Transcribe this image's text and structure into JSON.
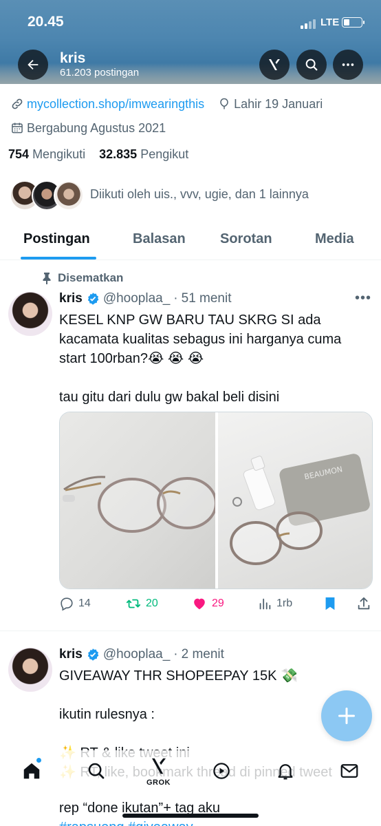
{
  "status_bar": {
    "time": "20.45",
    "network": "LTE"
  },
  "header": {
    "name": "kris",
    "post_count": "61.203 postingan"
  },
  "profile": {
    "website": "mycollection.shop/imwearingthis",
    "birthday": "Lahir 19 Januari",
    "joined": "Bergabung Agustus 2021",
    "following_count": "754",
    "following_label": "Mengikuti",
    "followers_count": "32.835",
    "followers_label": "Pengikut",
    "followed_by": "Diikuti oleh uis., vvv, ugie, dan 1 lainnya"
  },
  "tabs": [
    {
      "label": "Postingan",
      "active": true
    },
    {
      "label": "Balasan",
      "active": false
    },
    {
      "label": "Sorotan",
      "active": false
    },
    {
      "label": "Media",
      "active": false
    }
  ],
  "pinned_label": "Disematkan",
  "tweets": [
    {
      "name": "kris",
      "handle": "@hooplaa_",
      "sep": "·",
      "time": "51 menit",
      "text": "KESEL KNP GW BARU TAU SKRG SI ada kacamata kualitas sebagus ini harganya cuma start 100rban?😭 😭 😭\n\ntau gitu dari dulu gw bakal beli disini",
      "replies": "14",
      "retweets": "20",
      "likes": "29",
      "views": "1rb"
    },
    {
      "name": "kris",
      "handle": "@hooplaa_",
      "sep": "·",
      "time": "2 menit",
      "text": "GIVEAWAY THR SHOPEEPAY 15K 💸\n\nikutin rulesnya :\n\n✨ RT & like tweet ini\n✨ RT, like, bookmark thread di pinned tweet",
      "text_tail": "rep “done ikutan”+ tag aku",
      "hashtags": "#rapsueng #giveaway"
    }
  ],
  "bottom_nav": {
    "grok_label": "GROK"
  },
  "colors": {
    "accent": "#1d9bf0",
    "retweet": "#00ba7c",
    "like": "#f91880",
    "muted": "#536471"
  }
}
